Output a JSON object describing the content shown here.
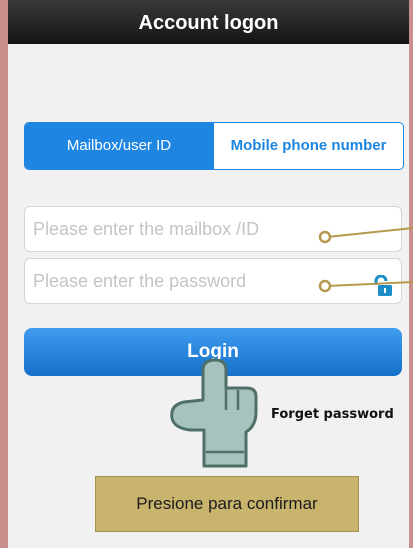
{
  "header": {
    "title": "Account logon"
  },
  "tabs": [
    {
      "label": "Mailbox/user ID",
      "selected": true
    },
    {
      "label": "Mobile phone number",
      "selected": false
    }
  ],
  "form": {
    "id_placeholder": "Please enter the mailbox /ID",
    "password_placeholder": "Please enter the password"
  },
  "login_label": "Login",
  "forget_label": "Forget password",
  "annotation": {
    "confirm_label": "Presione para confirmar"
  },
  "colors": {
    "accent": "#1e86e0",
    "callout": "#c9b46d",
    "lock_icon": "#1a8cc7"
  },
  "icons": {
    "password": "unlock-icon",
    "pointer": "hand-pointer-icon"
  }
}
